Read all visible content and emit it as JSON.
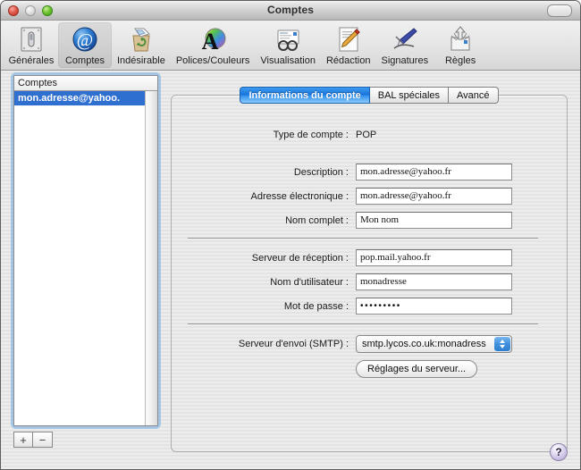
{
  "window": {
    "title": "Comptes",
    "traffic_lights": [
      "close-button",
      "minimize-button",
      "zoom-button"
    ],
    "toolbar_toggle": "toolbar-toggle-button"
  },
  "toolbar": {
    "items": [
      {
        "label": "Générales",
        "icon": "general-prefs-icon",
        "selected": false
      },
      {
        "label": "Comptes",
        "icon": "at-sign-icon",
        "selected": true
      },
      {
        "label": "Indésirable",
        "icon": "junk-mail-bin-icon",
        "selected": false
      },
      {
        "label": "Polices/Couleurs",
        "icon": "fonts-colors-icon",
        "selected": false
      },
      {
        "label": "Visualisation",
        "icon": "viewing-glasses-icon",
        "selected": false
      },
      {
        "label": "Rédaction",
        "icon": "compose-pencil-icon",
        "selected": false
      },
      {
        "label": "Signatures",
        "icon": "signature-pen-icon",
        "selected": false
      },
      {
        "label": "Règles",
        "icon": "rules-icon",
        "selected": false
      }
    ]
  },
  "sidebar": {
    "header": "Comptes",
    "accounts": [
      {
        "name": "mon.adresse@yahoo.",
        "selected": true
      }
    ],
    "add_label": "+",
    "remove_label": "−"
  },
  "tabs": [
    {
      "label": "Informations du compte",
      "active": true
    },
    {
      "label": "BAL spéciales",
      "active": false
    },
    {
      "label": "Avancé",
      "active": false
    }
  ],
  "form": {
    "account_type": {
      "label": "Type de compte :",
      "value": "POP"
    },
    "fields_group1": [
      {
        "label": "Description :",
        "value": "mon.adresse@yahoo.fr",
        "type": "text"
      },
      {
        "label": "Adresse électronique :",
        "value": "mon.adresse@yahoo.fr",
        "type": "text"
      },
      {
        "label": "Nom complet :",
        "value": "Mon nom",
        "type": "text"
      }
    ],
    "fields_group2": [
      {
        "label": "Serveur de réception :",
        "value": "pop.mail.yahoo.fr",
        "type": "text"
      },
      {
        "label": "Nom d'utilisateur :",
        "value": "monadresse",
        "type": "text"
      },
      {
        "label": "Mot de passe :",
        "value": "•••••••••",
        "type": "password"
      }
    ],
    "smtp": {
      "label": "Serveur d'envoi (SMTP) :",
      "value": "smtp.lycos.co.uk:monadress",
      "settings_button": "Réglages du serveur..."
    }
  },
  "help": {
    "label": "?"
  },
  "colors": {
    "accent_blue": "#1873d8",
    "selection_blue": "#2f6fd0",
    "window_bg": "#e9e9e9",
    "help_purple": "#c3b6e0"
  }
}
